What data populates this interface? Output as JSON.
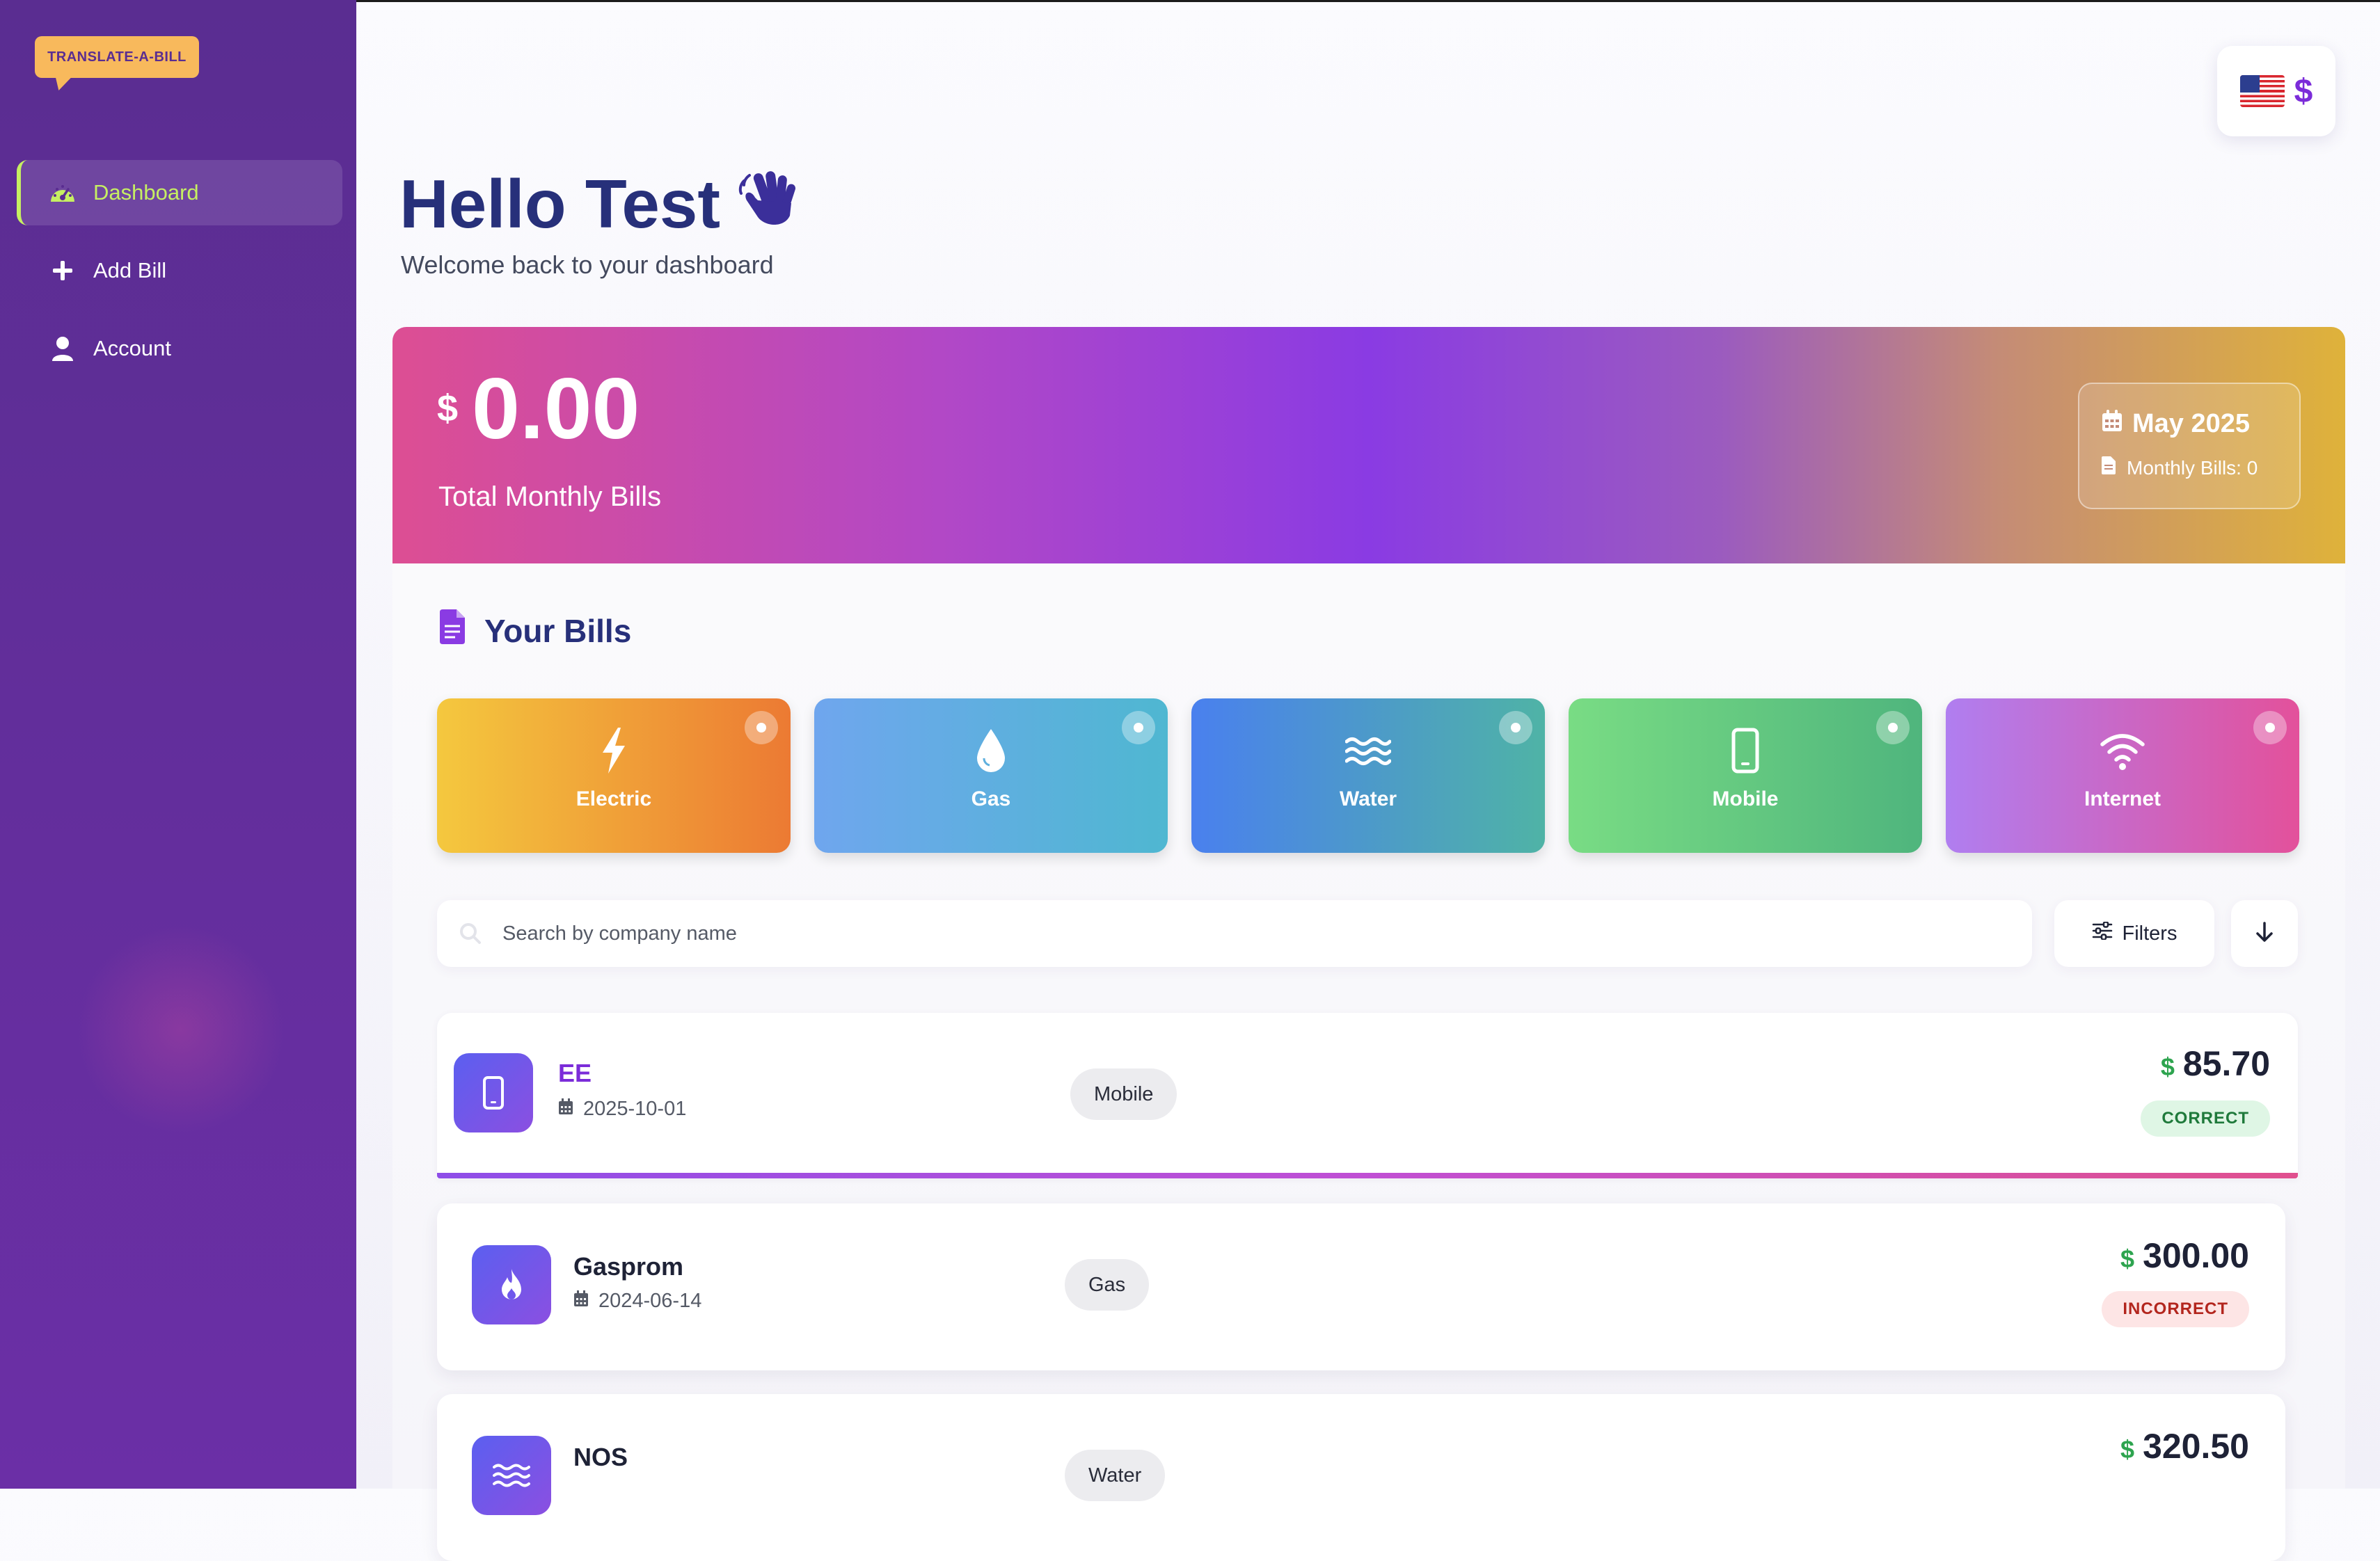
{
  "app": {
    "logo_text": "TRANSLATE-A-BILL"
  },
  "sidebar": {
    "items": [
      {
        "label": "Dashboard",
        "icon": "gauge-icon",
        "active": true
      },
      {
        "label": "Add Bill",
        "icon": "plus-icon",
        "active": false
      },
      {
        "label": "Account",
        "icon": "user-icon",
        "active": false
      }
    ]
  },
  "header": {
    "currency_symbol": "$",
    "greeting": "Hello Test",
    "subtitle": "Welcome back to your dashboard"
  },
  "summary": {
    "currency": "$",
    "total": "0.00",
    "total_label": "Total Monthly Bills",
    "month": "May 2025",
    "monthly_bills": "Monthly Bills: 0"
  },
  "bills": {
    "title": "Your Bills",
    "categories": [
      {
        "label": "Electric",
        "icon": "bolt-icon",
        "colors": [
          "#f4c83e",
          "#ec7a33"
        ]
      },
      {
        "label": "Gas",
        "icon": "drop-icon",
        "colors": [
          "#6fa6ee",
          "#4fb7d1"
        ]
      },
      {
        "label": "Water",
        "icon": "water-icon",
        "colors": [
          "#4a80ee",
          "#4fb3a6"
        ]
      },
      {
        "label": "Mobile",
        "icon": "phone-icon",
        "colors": [
          "#79dc84",
          "#4fb57d"
        ]
      },
      {
        "label": "Internet",
        "icon": "wifi-icon",
        "colors": [
          "#b07ef0",
          "#e3519b"
        ]
      }
    ],
    "search_placeholder": "Search by company name",
    "filters_label": "Filters",
    "list": [
      {
        "company": "EE",
        "date": "2025-10-01",
        "type": "Mobile",
        "currency": "$",
        "amount": "85.70",
        "status": "CORRECT",
        "icon": "phone-icon"
      },
      {
        "company": "Gasprom",
        "date": "2024-06-14",
        "type": "Gas",
        "currency": "$",
        "amount": "300.00",
        "status": "INCORRECT",
        "icon": "flame-icon"
      },
      {
        "company": "NOS",
        "date": "",
        "type": "Water",
        "currency": "$",
        "amount": "320.50",
        "status": "",
        "icon": "water-icon"
      }
    ]
  },
  "colors": {
    "sidebar": "#5a2d91",
    "accent_active": "#c6ef62",
    "title_navy": "#27307a",
    "ee_purple": "#7b2cd9",
    "positive": "#2ea44f"
  }
}
